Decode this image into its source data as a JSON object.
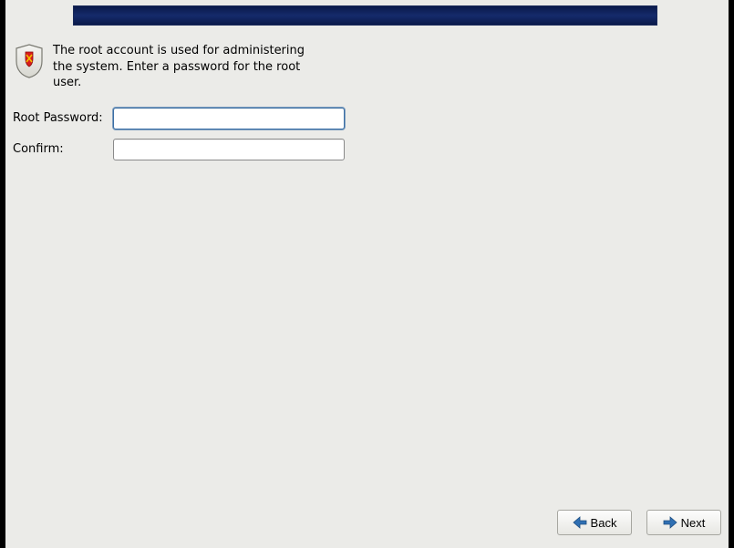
{
  "instruction": "The root account is used for administering the system.  Enter a password for the root user.",
  "fields": {
    "root_password": {
      "label": "Root Password:",
      "value": ""
    },
    "confirm": {
      "label": "Confirm:",
      "value": ""
    }
  },
  "buttons": {
    "back_label": "Back",
    "next_label": "Next"
  }
}
